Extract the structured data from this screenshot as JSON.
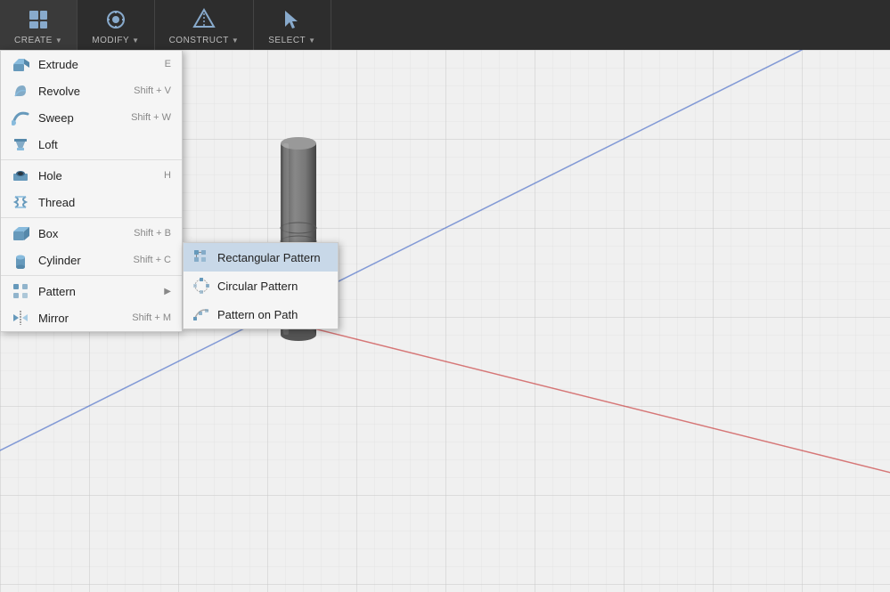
{
  "toolbar": {
    "items": [
      {
        "label": "CREATE",
        "id": "create"
      },
      {
        "label": "MODIFY",
        "id": "modify"
      },
      {
        "label": "CONSTRUCT",
        "id": "construct"
      },
      {
        "label": "SELECT",
        "id": "select"
      }
    ]
  },
  "create_menu": {
    "items": [
      {
        "label": "Extrude",
        "shortcut": "E",
        "icon": "extrude",
        "has_submenu": false
      },
      {
        "label": "Revolve",
        "shortcut": "Shift + V",
        "icon": "revolve",
        "has_submenu": false
      },
      {
        "label": "Sweep",
        "shortcut": "Shift + W",
        "icon": "sweep",
        "has_submenu": false
      },
      {
        "label": "Loft",
        "shortcut": "",
        "icon": "loft",
        "has_submenu": false
      },
      {
        "label": "Hole",
        "shortcut": "H",
        "icon": "hole",
        "has_submenu": false
      },
      {
        "label": "Thread",
        "shortcut": "",
        "icon": "thread",
        "has_submenu": false
      },
      {
        "label": "Box",
        "shortcut": "Shift + B",
        "icon": "box",
        "has_submenu": false
      },
      {
        "label": "Cylinder",
        "shortcut": "Shift + C",
        "icon": "cylinder",
        "has_submenu": false
      },
      {
        "label": "Pattern",
        "shortcut": "",
        "icon": "pattern",
        "has_submenu": true
      },
      {
        "label": "Mirror",
        "shortcut": "Shift + M",
        "icon": "mirror",
        "has_submenu": false
      }
    ]
  },
  "pattern_submenu": {
    "items": [
      {
        "label": "Rectangular Pattern",
        "icon": "rect-pattern",
        "active": true
      },
      {
        "label": "Circular Pattern",
        "icon": "circ-pattern",
        "active": false
      },
      {
        "label": "Pattern on Path",
        "icon": "path-pattern",
        "active": false
      }
    ]
  },
  "colors": {
    "toolbar_bg": "#2d2d2d",
    "menu_bg": "#f5f5f5",
    "viewport_bg": "#f0f0f0",
    "grid_line": "#d8d8d8",
    "axis_blue": "#5577cc",
    "axis_red": "#cc4444"
  }
}
